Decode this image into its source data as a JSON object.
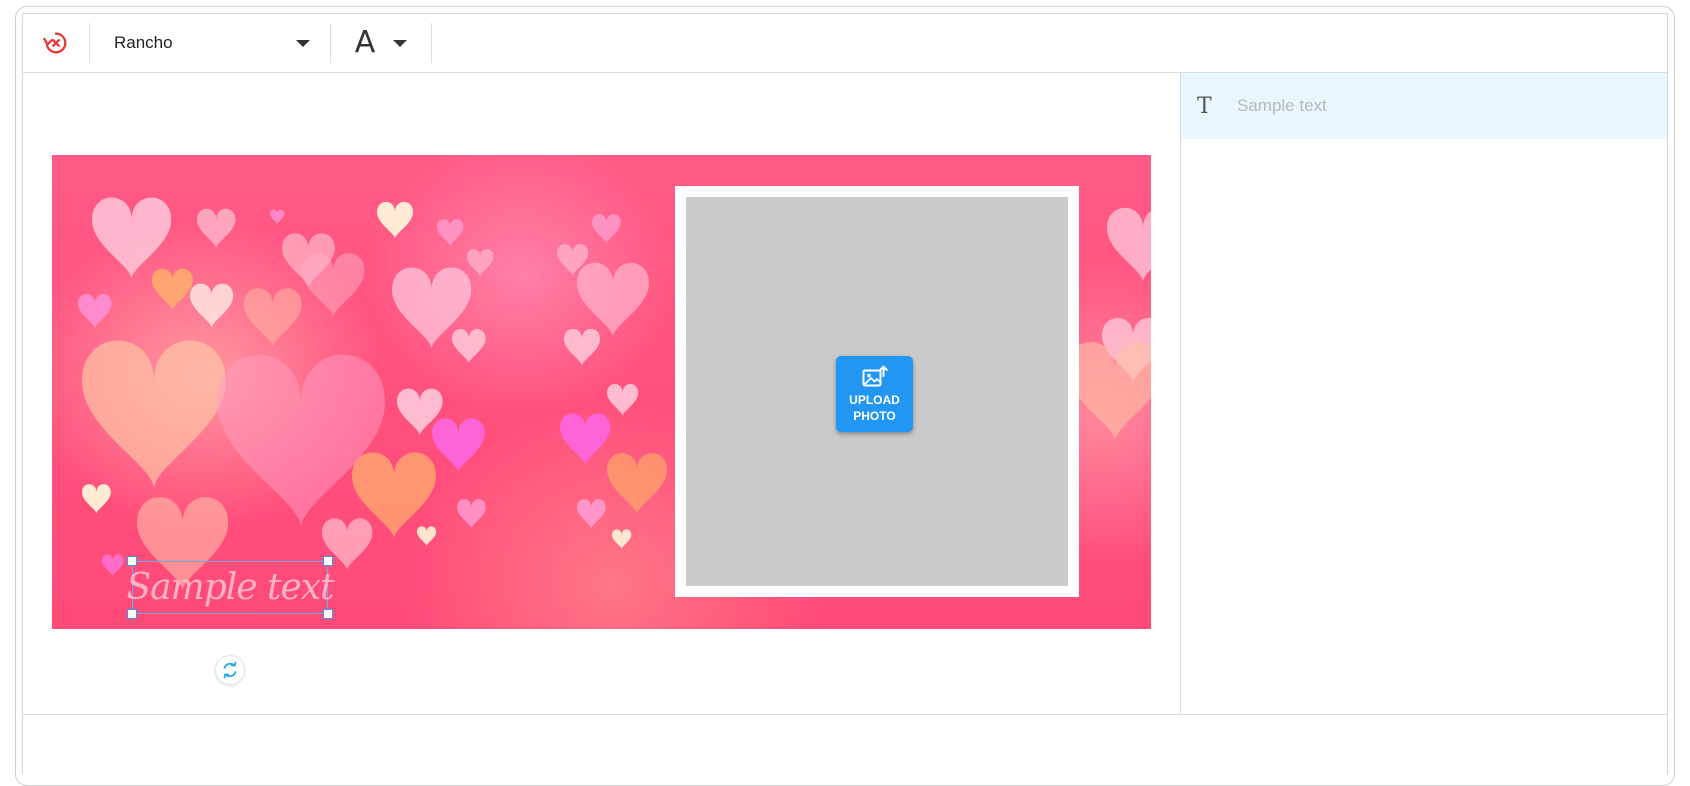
{
  "toolbar": {
    "font_name": "Rancho",
    "font_size_glyph": "A"
  },
  "canvas": {
    "text_layer": "Sample text",
    "upload_label": "UPLOAD\nPHOTO"
  },
  "layers_panel": {
    "items": [
      {
        "icon": "T",
        "label": "Sample text"
      }
    ]
  },
  "colors": {
    "accent": "#2196f3",
    "reset_icon": "#e53935",
    "card_background": "#ff4f7c",
    "selected_layer_bg": "#e9f6fd"
  }
}
